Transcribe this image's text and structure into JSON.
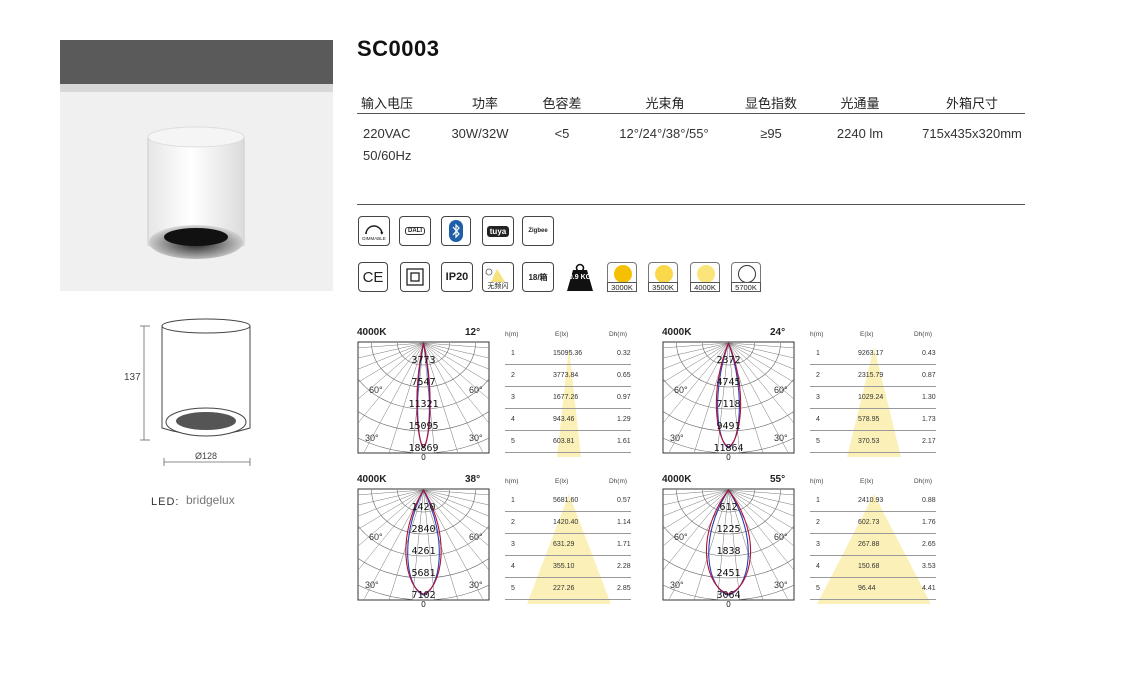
{
  "product": {
    "model": "SC0003"
  },
  "spec_table": {
    "headers": [
      "输入电压",
      "功率",
      "色容差",
      "光束角",
      "显色指数",
      "光通量",
      "外箱尺寸"
    ],
    "values": [
      "220VAC",
      "30W/32W",
      "<5",
      "12°/24°/38°/55°",
      "≥95",
      "2240 lm",
      "715x435x320mm"
    ],
    "voltage_line2": "50/60Hz"
  },
  "icons_row1": [
    {
      "name": "dimmable-icon",
      "label": "DIMMABLE"
    },
    {
      "name": "dali-icon",
      "label": "DALI"
    },
    {
      "name": "bluetooth-icon",
      "label": ""
    },
    {
      "name": "tuya-icon",
      "label": "tuya"
    },
    {
      "name": "zigbee-icon",
      "label": "Zigbee"
    }
  ],
  "icons_row2": [
    {
      "name": "ce-icon",
      "label": "CE"
    },
    {
      "name": "class-ii-icon",
      "label": ""
    },
    {
      "name": "ip-rating-icon",
      "label": "IP20"
    },
    {
      "name": "no-flicker-icon",
      "label": "无频闪"
    },
    {
      "name": "pack-qty-icon",
      "label": "18/箱"
    },
    {
      "name": "weight-icon",
      "label": "0.9 KG"
    }
  ],
  "cct_options": [
    {
      "label": "3000K",
      "color": "#f5c000"
    },
    {
      "label": "3500K",
      "color": "#fbd84a"
    },
    {
      "label": "4000K",
      "color": "#fbe57a"
    },
    {
      "label": "5700K",
      "color": "#ffffff"
    }
  ],
  "drawing": {
    "height": "137",
    "diameter": "Ø128",
    "led_label": "LED:",
    "led_brand": "bridgelux"
  },
  "photometrics": [
    {
      "cct": "4000K",
      "angle": "12°",
      "rings": [
        "3773",
        "7547",
        "11321",
        "15095",
        "18869"
      ],
      "angles": [
        "60°",
        "60°",
        "30°",
        "30°",
        "0"
      ],
      "table": {
        "headers": [
          "h(m)",
          "E(lx)",
          "Dh(m)"
        ],
        "rows": [
          [
            "1",
            "15095.36",
            "0.32"
          ],
          [
            "2",
            "3773.84",
            "0.65"
          ],
          [
            "3",
            "1677.26",
            "0.97"
          ],
          [
            "4",
            "943.46",
            "1.29"
          ],
          [
            "5",
            "603.81",
            "1.61"
          ]
        ]
      }
    },
    {
      "cct": "4000K",
      "angle": "24°",
      "rings": [
        "2372",
        "4745",
        "7118",
        "9491",
        "11864"
      ],
      "angles": [
        "60°",
        "60°",
        "30°",
        "30°",
        "0"
      ],
      "table": {
        "headers": [
          "h(m)",
          "E(lx)",
          "Dh(m)"
        ],
        "rows": [
          [
            "1",
            "9263.17",
            "0.43"
          ],
          [
            "2",
            "2315.79",
            "0.87"
          ],
          [
            "3",
            "1029.24",
            "1.30"
          ],
          [
            "4",
            "578.95",
            "1.73"
          ],
          [
            "5",
            "370.53",
            "2.17"
          ]
        ]
      }
    },
    {
      "cct": "4000K",
      "angle": "38°",
      "rings": [
        "1420",
        "2840",
        "4261",
        "5681",
        "7102"
      ],
      "angles": [
        "60°",
        "60°",
        "30°",
        "30°",
        "0"
      ],
      "table": {
        "headers": [
          "h(m)",
          "E(lx)",
          "Dh(m)"
        ],
        "rows": [
          [
            "1",
            "5681.60",
            "0.57"
          ],
          [
            "2",
            "1420.40",
            "1.14"
          ],
          [
            "3",
            "631.29",
            "1.71"
          ],
          [
            "4",
            "355.10",
            "2.28"
          ],
          [
            "5",
            "227.26",
            "2.85"
          ]
        ]
      }
    },
    {
      "cct": "4000K",
      "angle": "55°",
      "rings": [
        "612",
        "1225",
        "1838",
        "2451",
        "3064"
      ],
      "angles": [
        "60°",
        "60°",
        "30°",
        "30°",
        "0"
      ],
      "table": {
        "headers": [
          "h(m)",
          "E(lx)",
          "Dh(m)"
        ],
        "rows": [
          [
            "1",
            "2410.93",
            "0.88"
          ],
          [
            "2",
            "602.73",
            "1.76"
          ],
          [
            "3",
            "267.88",
            "2.65"
          ],
          [
            "4",
            "150.68",
            "3.53"
          ],
          [
            "5",
            "96.44",
            "4.41"
          ]
        ]
      }
    }
  ]
}
